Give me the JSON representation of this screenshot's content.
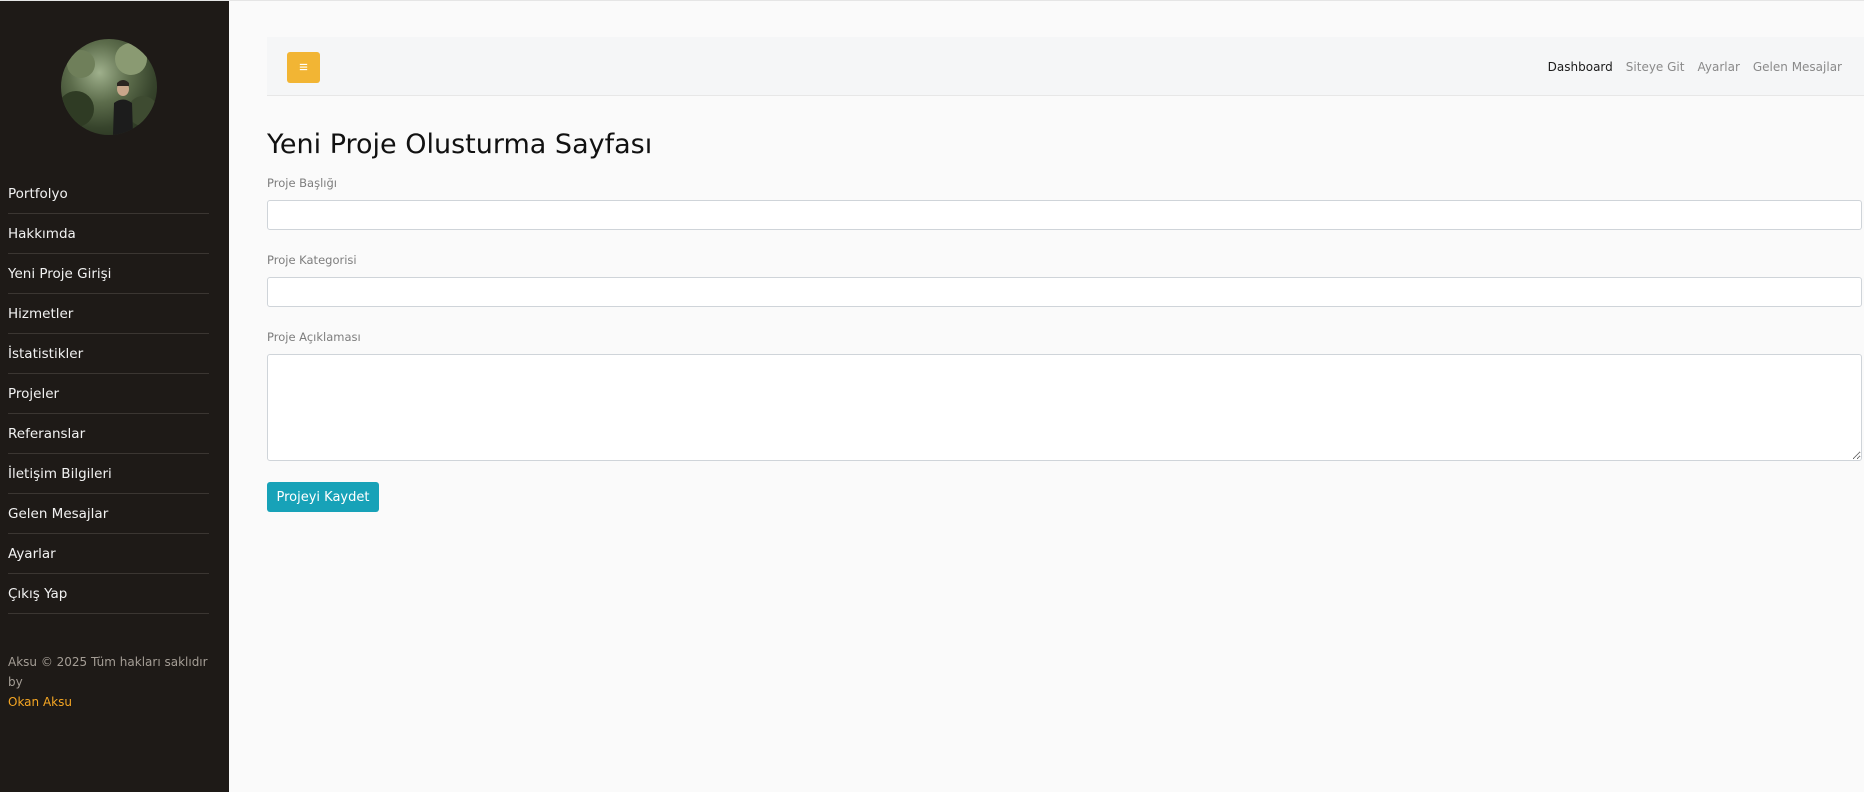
{
  "sidebar": {
    "avatar_alt": "Profile photo",
    "items": [
      {
        "label": "Portfolyo"
      },
      {
        "label": "Hakkımda"
      },
      {
        "label": "Yeni Proje Girişi"
      },
      {
        "label": "Hizmetler"
      },
      {
        "label": "İstatistikler"
      },
      {
        "label": "Projeler"
      },
      {
        "label": "Referanslar"
      },
      {
        "label": "İletişim Bilgileri"
      },
      {
        "label": "Gelen Mesajlar"
      },
      {
        "label": "Ayarlar"
      },
      {
        "label": "Çıkış Yap"
      }
    ],
    "footer": {
      "text": "Aksu © 2025 Tüm hakları saklıdır by",
      "link": "Okan Aksu"
    }
  },
  "topbar": {
    "toggle_icon": "hamburger-icon",
    "toggle_glyph": "≡",
    "links": [
      {
        "label": "Dashboard"
      },
      {
        "label": "Siteye Git"
      },
      {
        "label": "Ayarlar"
      },
      {
        "label": "Gelen Mesajlar"
      }
    ]
  },
  "form": {
    "title": "Yeni Proje Olusturma Sayfası",
    "fields": [
      {
        "label": "Proje Başlığı",
        "value": ""
      },
      {
        "label": "Proje Kategorisi",
        "value": ""
      },
      {
        "label": "Proje Açıklaması",
        "value": ""
      }
    ],
    "submit_label": "Projeyi Kaydet"
  },
  "colors": {
    "sidebar_bg": "#1e1a17",
    "accent_yellow": "#f2b534",
    "footer_link": "#f5a623",
    "button_teal": "#17a2b8"
  }
}
